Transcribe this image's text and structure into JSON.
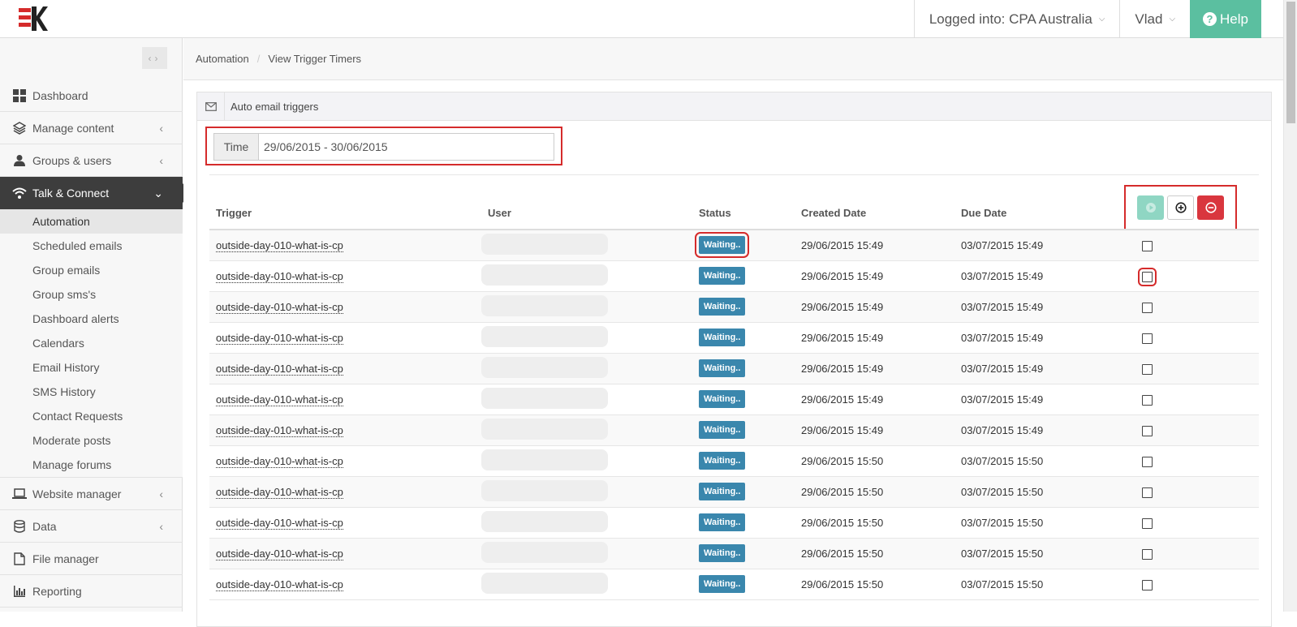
{
  "topbar": {
    "logged_into": "Logged into: CPA Australia",
    "user": "Vlad",
    "help": "Help"
  },
  "sidebar": {
    "items": [
      {
        "label": "Dashboard",
        "icon": "dashboard-icon"
      },
      {
        "label": "Manage content",
        "icon": "layers-icon"
      },
      {
        "label": "Groups & users",
        "icon": "user-icon"
      },
      {
        "label": "Talk & Connect",
        "icon": "wifi-icon"
      }
    ],
    "sub_items": [
      "Automation",
      "Scheduled emails",
      "Group emails",
      "Group sms's",
      "Dashboard alerts",
      "Calendars",
      "Email History",
      "SMS History",
      "Contact Requests",
      "Moderate posts",
      "Manage forums"
    ],
    "items_after": [
      {
        "label": "Website manager",
        "icon": "laptop-icon"
      },
      {
        "label": "Data",
        "icon": "database-icon"
      },
      {
        "label": "File manager",
        "icon": "file-icon"
      },
      {
        "label": "Reporting",
        "icon": "bar-chart-icon"
      }
    ]
  },
  "breadcrumb": {
    "root": "Automation",
    "current": "View Trigger Timers"
  },
  "panel": {
    "title": "Auto email triggers"
  },
  "filter": {
    "label": "Time",
    "value": "29/06/2015 - 30/06/2015"
  },
  "table": {
    "headers": {
      "trigger": "Trigger",
      "user": "User",
      "status": "Status",
      "created": "Created Date",
      "due": "Due Date"
    },
    "rows": [
      {
        "trigger": "outside-day-010-what-is-cp",
        "status": "Waiting..",
        "created": "29/06/2015 15:49",
        "due": "03/07/2015 15:49"
      },
      {
        "trigger": "outside-day-010-what-is-cp",
        "status": "Waiting..",
        "created": "29/06/2015 15:49",
        "due": "03/07/2015 15:49"
      },
      {
        "trigger": "outside-day-010-what-is-cp",
        "status": "Waiting..",
        "created": "29/06/2015 15:49",
        "due": "03/07/2015 15:49"
      },
      {
        "trigger": "outside-day-010-what-is-cp",
        "status": "Waiting..",
        "created": "29/06/2015 15:49",
        "due": "03/07/2015 15:49"
      },
      {
        "trigger": "outside-day-010-what-is-cp",
        "status": "Waiting..",
        "created": "29/06/2015 15:49",
        "due": "03/07/2015 15:49"
      },
      {
        "trigger": "outside-day-010-what-is-cp",
        "status": "Waiting..",
        "created": "29/06/2015 15:49",
        "due": "03/07/2015 15:49"
      },
      {
        "trigger": "outside-day-010-what-is-cp",
        "status": "Waiting..",
        "created": "29/06/2015 15:49",
        "due": "03/07/2015 15:49"
      },
      {
        "trigger": "outside-day-010-what-is-cp",
        "status": "Waiting..",
        "created": "29/06/2015 15:50",
        "due": "03/07/2015 15:50"
      },
      {
        "trigger": "outside-day-010-what-is-cp",
        "status": "Waiting..",
        "created": "29/06/2015 15:50",
        "due": "03/07/2015 15:50"
      },
      {
        "trigger": "outside-day-010-what-is-cp",
        "status": "Waiting..",
        "created": "29/06/2015 15:50",
        "due": "03/07/2015 15:50"
      },
      {
        "trigger": "outside-day-010-what-is-cp",
        "status": "Waiting..",
        "created": "29/06/2015 15:50",
        "due": "03/07/2015 15:50"
      },
      {
        "trigger": "outside-day-010-what-is-cp",
        "status": "Waiting..",
        "created": "29/06/2015 15:50",
        "due": "03/07/2015 15:50"
      }
    ]
  },
  "colors": {
    "accent": "#5bbfa0",
    "badge": "#3a87ad",
    "danger": "#d9363e",
    "highlight": "#d52b2b",
    "nav_active": "#3d3d3d"
  }
}
